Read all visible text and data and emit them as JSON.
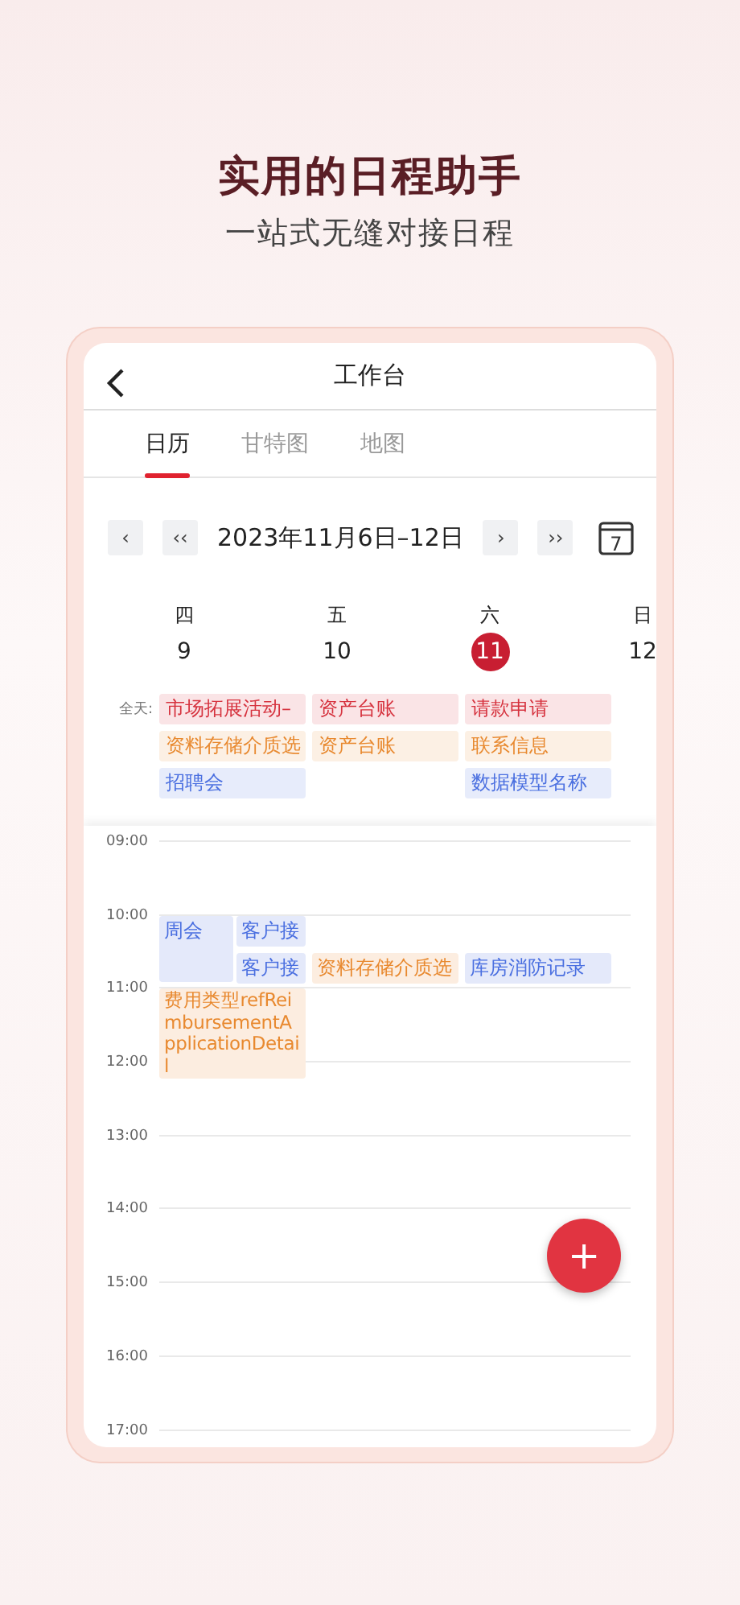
{
  "headline": "实用的日程助手",
  "subheadline": "一站式无缝对接日程",
  "app_bar": {
    "title": "工作台"
  },
  "tabs": [
    {
      "label": "日历",
      "selected": true
    },
    {
      "label": "甘特图",
      "selected": false
    },
    {
      "label": "地图",
      "selected": false
    }
  ],
  "week_nav": {
    "prev": "‹",
    "prev_fast": "‹‹",
    "range": "2023年11月6日–12日",
    "next": "›",
    "next_fast": "››",
    "today_icon_day": "7"
  },
  "days": [
    {
      "weekday": "四",
      "date": "9",
      "selected": false
    },
    {
      "weekday": "五",
      "date": "10",
      "selected": false
    },
    {
      "weekday": "六",
      "date": "11",
      "selected": true
    },
    {
      "weekday": "日",
      "date": "12",
      "selected": false
    }
  ],
  "all_day_label": "全天:",
  "all_day": [
    [
      {
        "title": "市场拓展活动–",
        "color": "#d6333f"
      },
      {
        "title": "资料存储介质选",
        "color": "#e8892f"
      },
      {
        "title": "招聘会",
        "color": "#4a6fe0"
      }
    ],
    [
      {
        "title": "资产台账",
        "color": "#d6333f"
      },
      {
        "title": "资产台账",
        "color": "#e8892f"
      }
    ],
    [
      {
        "title": "请款申请",
        "color": "#d6333f"
      },
      {
        "title": "联系信息",
        "color": "#e8892f"
      },
      {
        "title": "数据模型名称",
        "color": "#4a6fe0"
      }
    ]
  ],
  "hours": [
    "09:00",
    "10:00",
    "11:00",
    "12:00",
    "13:00",
    "14:00",
    "15:00",
    "16:00",
    "17:00"
  ],
  "events": [
    [
      {
        "title": "周会",
        "color": "#4a6fe0"
      },
      {
        "title": "客户接",
        "color": "#4a6fe0"
      },
      {
        "title": "客户接",
        "color": "#4a6fe0"
      },
      {
        "title": "费用类型refReimbursementApplicationDetail",
        "color": "#e8892f"
      }
    ],
    [
      {
        "title": "资料存储介质选",
        "color": "#e8892f"
      }
    ],
    [
      {
        "title": "库房消防记录",
        "color": "#4a6fe0"
      }
    ]
  ],
  "fab": {
    "label": "+"
  }
}
